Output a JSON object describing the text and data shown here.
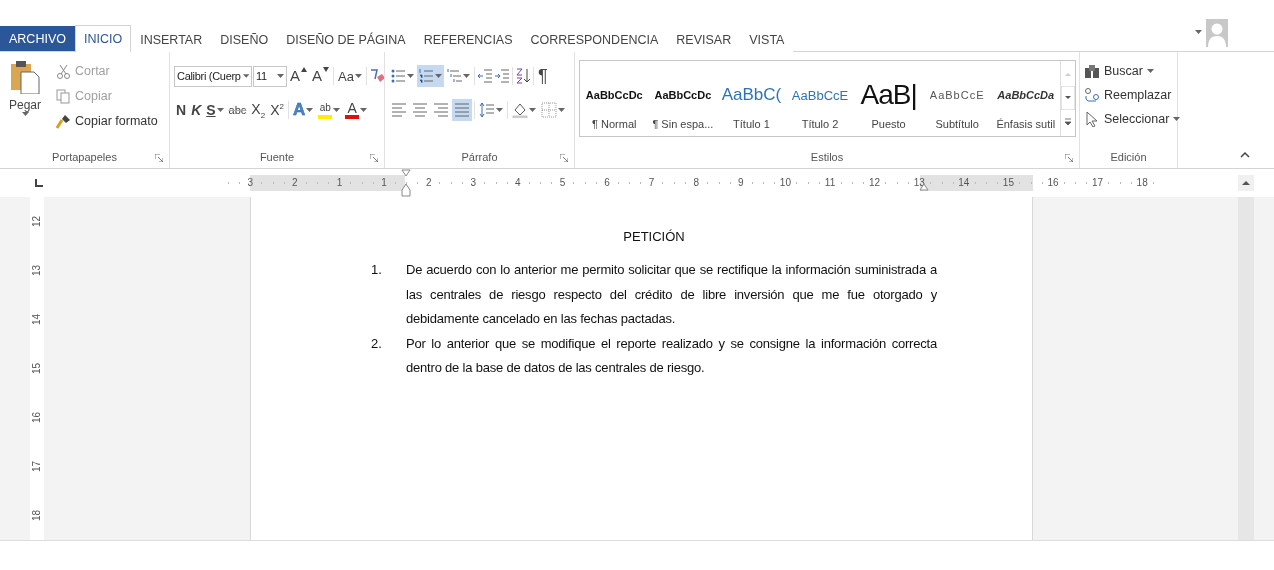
{
  "tabs": [
    {
      "label": "ARCHIVO",
      "kind": "file",
      "selected": false
    },
    {
      "label": "INICIO",
      "kind": "tab",
      "selected": true
    },
    {
      "label": "INSERTAR",
      "kind": "tab",
      "selected": false
    },
    {
      "label": "DISEÑO",
      "kind": "tab",
      "selected": false
    },
    {
      "label": "DISEÑO DE PÁGINA",
      "kind": "tab",
      "selected": false
    },
    {
      "label": "REFERENCIAS",
      "kind": "tab",
      "selected": false
    },
    {
      "label": "CORRESPONDENCIA",
      "kind": "tab",
      "selected": false
    },
    {
      "label": "REVISAR",
      "kind": "tab",
      "selected": false
    },
    {
      "label": "VISTA",
      "kind": "tab",
      "selected": false
    }
  ],
  "clipboard": {
    "label": "Portapapeles",
    "paste": "Pegar",
    "actions": [
      {
        "label": "Cortar",
        "kind": "cut",
        "disabled": true
      },
      {
        "label": "Copiar",
        "kind": "copy",
        "disabled": true
      },
      {
        "label": "Copiar formato",
        "kind": "format-painter",
        "disabled": false
      }
    ]
  },
  "font": {
    "label": "Fuente",
    "font_name": "Calibri (Cuerp",
    "font_size": "11",
    "size_tools": [
      {
        "glyph": "A",
        "kind": "grow"
      },
      {
        "glyph": "A",
        "kind": "shrink"
      }
    ],
    "case_button": "Aa",
    "format_buttons": [
      {
        "text": "N",
        "kind": "bold"
      },
      {
        "text": "K",
        "kind": "italic"
      },
      {
        "text": "S",
        "kind": "underline"
      },
      {
        "text": "abc",
        "kind": "strike"
      },
      {
        "text": "X$_{2}$",
        "kind": "sub"
      },
      {
        "text": "X$^{2}$",
        "kind": "sup"
      }
    ],
    "color_buttons": [
      {
        "glyph": "A",
        "kind": "effects",
        "color": "#4a86c8"
      },
      {
        "glyph": "ab",
        "kind": "highlight",
        "color": "#ffee00"
      },
      {
        "glyph": "A",
        "kind": "font-color",
        "color": "#e01010"
      }
    ]
  },
  "paragraph": {
    "label": "Párrafo",
    "pilcrow": "¶",
    "list_buttons": [
      {
        "kind": "bullets",
        "selected": false
      },
      {
        "kind": "numbering",
        "selected": true
      },
      {
        "kind": "multilevel",
        "selected": false
      }
    ],
    "alignment": [
      {
        "kind": "left",
        "selected": false
      },
      {
        "kind": "center",
        "selected": false
      },
      {
        "kind": "right",
        "selected": false
      },
      {
        "kind": "justify",
        "selected": true
      }
    ]
  },
  "styles": {
    "label": "Estilos",
    "items": [
      {
        "preview": "AaBbCcDc",
        "name": "¶ Normal",
        "kind": "normal"
      },
      {
        "preview": "AaBbCcDc",
        "name": "¶ Sin espa...",
        "kind": "normal"
      },
      {
        "preview": "AaBbC(",
        "name": "Título 1",
        "kind": "heading1"
      },
      {
        "preview": "AaBbCcE",
        "name": "Título 2",
        "kind": "heading2"
      },
      {
        "preview": "AaB|",
        "name": "Puesto",
        "kind": "title"
      },
      {
        "preview": "AaBbCcE",
        "name": "Subtítulo",
        "kind": "subtitle"
      },
      {
        "preview": "AaBbCcDa",
        "name": "Énfasis sutil",
        "kind": "emphasis"
      }
    ]
  },
  "editing": {
    "label": "Edición",
    "items": [
      {
        "label": "Buscar",
        "kind": "find",
        "dropdown": true
      },
      {
        "label": "Reemplazar",
        "kind": "replace",
        "dropdown": false
      },
      {
        "label": "Seleccionar",
        "kind": "select",
        "dropdown": true
      }
    ]
  },
  "ruler": {
    "labels": [
      "3",
      "2",
      "1",
      "1",
      "2",
      "3",
      "4",
      "5",
      "6",
      "7",
      "8",
      "9",
      "10",
      "11",
      "12",
      "13",
      "14",
      "15",
      "16",
      "17",
      "18"
    ]
  },
  "vertical_ruler": {
    "labels": [
      "12",
      "13",
      "14",
      "15",
      "16",
      "17",
      "18"
    ]
  },
  "document": {
    "title": "PETICIÓN",
    "items": [
      {
        "number": "1.",
        "text": "De acuerdo con lo anterior me permito solicitar que se rectifique la información suministrada a las centrales de riesgo respecto del crédito de libre inversión que me fue otorgado y debidamente cancelado en las fechas pactadas."
      },
      {
        "number": "2.",
        "text": "Por lo anterior que se modifique el reporte realizado y se consigne la información correcta dentro de la base de datos de las centrales de riesgo."
      }
    ]
  }
}
